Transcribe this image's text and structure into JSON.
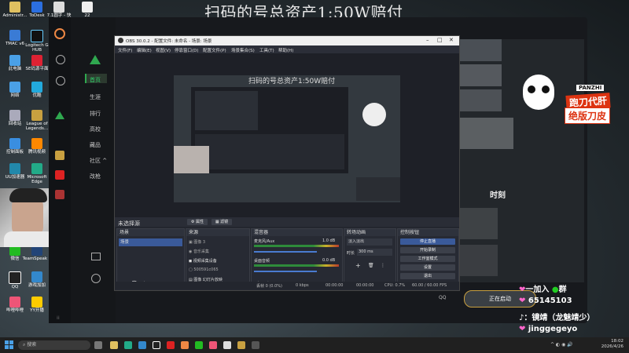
{
  "overlay": {
    "title": "扫码的号总资产1:50W赔付",
    "contact": "一加入",
    "contact_suffix": "群",
    "group_number": "65145103",
    "douyin_label": "：镜靖（龙魅靖少）",
    "handle": "jinggegeyo"
  },
  "promo": {
    "brand": "PANZHI",
    "line1": "跑刀代肝",
    "line2": "绝版刀皮"
  },
  "desktop_icons": [
    {
      "label": "Administr..."
    },
    {
      "label": "ToDesk"
    },
    {
      "label": "7.1圆字 - 快"
    },
    {
      "label": "22"
    },
    {
      "label": "TMAC v6"
    },
    {
      "label": "Logitech G HUB"
    },
    {
      "label": "此电脑"
    },
    {
      "label": "SE码源平面"
    },
    {
      "label": "网络"
    },
    {
      "label": "优酷"
    },
    {
      "label": "回收站"
    },
    {
      "label": "League of Legends..."
    },
    {
      "label": "控制面板"
    },
    {
      "label": "腾讯视频"
    },
    {
      "label": "UU加速器"
    },
    {
      "label": "Microsoft Edge"
    },
    {
      "label": "微信"
    },
    {
      "label": "TeamSpeak 3"
    },
    {
      "label": "QQ"
    },
    {
      "label": "游戏加加"
    },
    {
      "label": "哔哩哔哩"
    },
    {
      "label": "YY开播"
    }
  ],
  "launcher": {
    "nav": [
      "首页",
      "生涯",
      "排行",
      "高校",
      "藏品",
      "社区",
      "改枪"
    ],
    "community_arrow": "^",
    "start_label": "正在启动",
    "qq_label": "QQ",
    "right_heading_1": "时刻"
  },
  "obs": {
    "title": "OBS 30.0.2 - 配置文件: 未命名 - 场景: 场景",
    "menus": [
      "文件(F)",
      "编辑(E)",
      "视图(V)",
      "停靠窗口(D)",
      "配置文件(P)",
      "场景集合(S)",
      "工具(T)",
      "帮助(H)"
    ],
    "no_source": "未选择源",
    "props_btn": "属性",
    "filters_btn": "滤镜",
    "docks": {
      "scenes": "场景",
      "sources": "来源",
      "mixer": "混音器",
      "transitions": "转场动画",
      "controls": "控制按钮"
    },
    "scene_item": "场景",
    "sources": [
      "图像 3",
      "音乐采集",
      "视频采集设备",
      "500591c065",
      "图像 幻灯片放映"
    ],
    "mixer": [
      {
        "name": "麦克风/Aux",
        "db": "1.0 dB"
      },
      {
        "name": "桌面音频",
        "db": "0.0 dB"
      }
    ],
    "transition": {
      "value": "淡入淡出",
      "duration_label": "时长",
      "duration": "300 ms"
    },
    "controls": [
      "停止直播",
      "开始录制",
      "工作室模式",
      "设置",
      "退出"
    ],
    "status": {
      "dropped": "丢帧 0 (0.0%)",
      "bitrate": "0 kbps",
      "time1": "00:00:00",
      "time2": "00:00:00",
      "cpu": "CPU: 0.7%",
      "fps": "60.00 / 60.00 FPS"
    }
  },
  "taskbar": {
    "search": "搜索",
    "time": "18:02",
    "date": "2026/4/26"
  }
}
